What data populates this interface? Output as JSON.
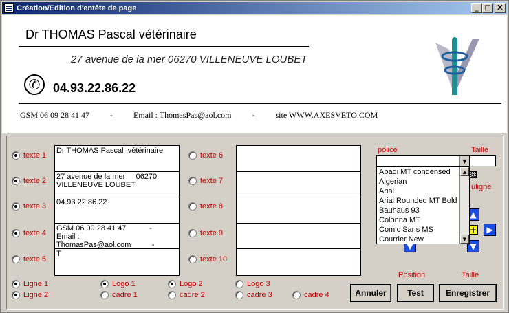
{
  "window": {
    "title": "Création/Edition d'entête de page",
    "minimize": "_",
    "maximize": "□",
    "close": "X"
  },
  "header": {
    "name": "Dr THOMAS Pascal  vétérinaire",
    "address": "27 avenue de la mer     06270 VILLENEUVE LOUBET",
    "phone": "04.93.22.86.22",
    "phone_icon": "telephone-icon",
    "info": "GSM 06 09 28 41 47          -          Email : ThomasPas@aol.com          -          site WWW.AXESVETO.COM"
  },
  "texts_left": [
    {
      "label": "texte 1",
      "value": "Dr THOMAS Pascal  vétérinaire",
      "selected": true
    },
    {
      "label": "texte 2",
      "value": "27 avenue de la mer     06270\nVILLENEUVE LOUBET",
      "selected": true
    },
    {
      "label": "texte 3",
      "value": "04.93.22.86.22",
      "selected": true
    },
    {
      "label": "texte 4",
      "value": "GSM 06 09 28 41 47           -\nEmail :\nThomasPas@aol.com          -",
      "selected": true
    },
    {
      "label": "texte 5",
      "value": "T",
      "selected": false
    }
  ],
  "texts_right": [
    {
      "label": "texte 6",
      "value": "",
      "selected": false
    },
    {
      "label": "texte 7",
      "value": "",
      "selected": false
    },
    {
      "label": "texte 8",
      "value": "",
      "selected": false
    },
    {
      "label": "texte 9",
      "value": "",
      "selected": false
    },
    {
      "label": "texte 10",
      "value": "",
      "selected": false
    }
  ],
  "options": {
    "ligne1": "Ligne 1",
    "ligne2": "Ligne 2",
    "logo1": "Logo 1",
    "logo2": "Logo 2",
    "logo3": "Logo 3",
    "cadre1": "cadre 1",
    "cadre2": "cadre 2",
    "cadre3": "cadre 3",
    "cadre4": "cadre 4"
  },
  "format": {
    "police_label": "police",
    "taille_label": "Taille",
    "souligne_label": "uligne",
    "position_label": "Position",
    "taille_label2": "Taille",
    "fonts": [
      "Abadi MT condensed",
      "Algerian",
      "Arial",
      "Arial Rounded MT Bold",
      "Bauhaus 93",
      "Colonna MT",
      "Comic Sans MS",
      "Courrier New"
    ]
  },
  "buttons": {
    "annuler": "Annuler",
    "test": "Test",
    "enregistrer": "Enregistrer"
  },
  "colors": {
    "label_red": "#c00000",
    "arrow_blue": "#1a4de0"
  }
}
